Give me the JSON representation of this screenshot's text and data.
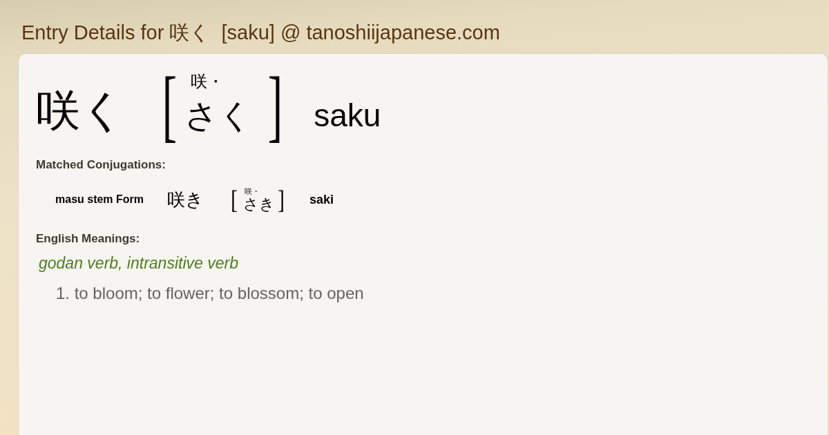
{
  "page": {
    "title": "Entry Details for 咲く  [saku] @ tanoshiijapanese.com"
  },
  "entry": {
    "word": "咲く",
    "bracket_open": "[",
    "furigana": "咲・",
    "reading": "さく",
    "bracket_close": "]",
    "romaji": "saku"
  },
  "conjugations": {
    "heading": "Matched Conjugations:",
    "items": [
      {
        "form": "masu stem Form",
        "word": "咲き",
        "bracket_open": "[",
        "furigana": "咲・",
        "reading": "さき",
        "bracket_close": "]",
        "romaji": "saki"
      }
    ]
  },
  "meanings": {
    "heading": "English Meanings:",
    "groups": [
      {
        "part_of_speech": "godan verb, intransitive verb",
        "senses": [
          "1. to bloom; to flower; to blossom; to open"
        ]
      }
    ]
  }
}
